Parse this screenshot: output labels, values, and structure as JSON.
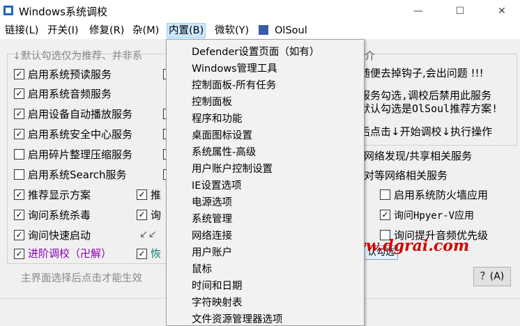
{
  "window": {
    "title": "Windows系统调校",
    "minimize": "—",
    "maximize": "☐",
    "close": "✕"
  },
  "menu": {
    "items": [
      "链接(L)",
      "开关(I)",
      "修复(R)",
      "杂(M)",
      "内置(B)",
      "微软(Y)",
      "OlSoul"
    ],
    "active_index": 4
  },
  "hint": "↓默认勾选仅为推荐、并非系",
  "left_options": [
    {
      "label": "启用系统预读服务",
      "checked": true
    },
    {
      "label": "启用系统音频服务",
      "checked": true
    },
    {
      "label": "启用设备自动播放服务",
      "checked": true
    },
    {
      "label": "启用系统安全中心服务",
      "checked": true
    },
    {
      "label": "启用碎片整理压缩服务",
      "checked": false
    },
    {
      "label": "启用系统Search服务",
      "checked": false
    }
  ],
  "lower_left": [
    {
      "label": "推荐显示方案",
      "checked": true
    },
    {
      "label": "询问系统杀毒",
      "checked": true
    },
    {
      "label": "询问快速启动",
      "checked": true
    },
    {
      "label": "进阶调校（卍解）",
      "checked": true
    }
  ],
  "lower_mid": [
    {
      "label": "推",
      "checked": true
    },
    {
      "label": "询",
      "checked": true
    },
    {
      "label": "恢",
      "checked": true
    }
  ],
  "arrows": "↙↙",
  "right_info": {
    "heading": "简介",
    "line1": "随便去掉钩子,会出问题 !!!",
    "line2": "服务勾选,调校后禁用此服务",
    "line3": "默认勾选是OlSoul推荐方案!",
    "line4": "后点击↓开始调校↓执行操作"
  },
  "right_lines": [
    "网络发现/共享相关服务",
    "对等网络相关服务"
  ],
  "right_options": [
    {
      "label": "启用系统防火墙应用",
      "checked": false
    },
    {
      "label": "询问Hpyer-V应用",
      "checked": true
    },
    {
      "label": "询问提升音频优先级",
      "checked": false
    }
  ],
  "partial_button": "认勾选",
  "status": "主界面选择后点击才能生效",
  "help_button": "？(A)",
  "watermark": "www.dgrai.com",
  "popup_items": [
    "Defender设置页面（如有）",
    "Windows管理工具",
    "控制面板-所有任务",
    "控制面板",
    "程序和功能",
    "桌面图标设置",
    "系统属性-高级",
    "用户账户控制设置",
    "IE设置选项",
    "电源选项",
    "系统管理",
    "网络连接",
    "用户账户",
    "鼠标",
    "时间和日期",
    "字符映射表",
    "文件资源管理器选项"
  ]
}
